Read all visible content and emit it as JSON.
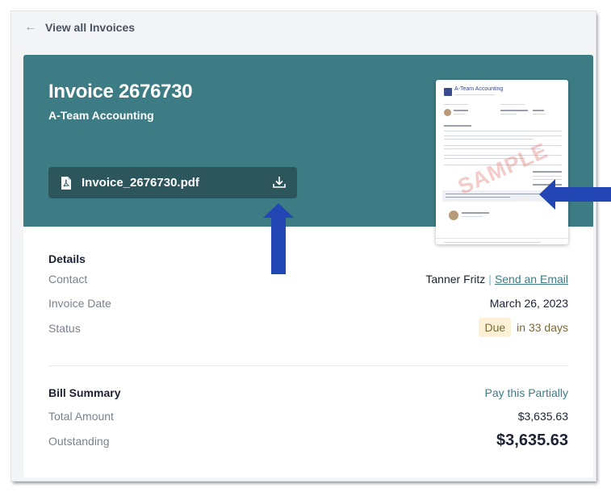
{
  "nav": {
    "back_label": "View all Invoices",
    "back_icon": "arrow-left-icon"
  },
  "invoice": {
    "title": "Invoice 2676730",
    "company": "A-Team Accounting",
    "file_name": "Invoice_2676730.pdf",
    "file_icon": "pdf-file-icon",
    "download_icon": "download-icon"
  },
  "preview": {
    "company_name": "A-Team Accounting",
    "watermark": "SAMPLE"
  },
  "details": {
    "heading": "Details",
    "contact_label": "Contact",
    "contact_name": "Tanner Fritz",
    "separator": "|",
    "contact_link": "Send an Email",
    "date_label": "Invoice Date",
    "date_value": "March 26, 2023",
    "status_label": "Status",
    "status_badge": "Due",
    "status_rest": "in 33 days"
  },
  "bill": {
    "heading": "Bill Summary",
    "pay_link": "Pay this Partially",
    "total_label": "Total Amount",
    "total_value": "$3,635.63",
    "outstanding_label": "Outstanding",
    "outstanding_value": "$3,635.63"
  },
  "colors": {
    "hero": "#3d7c85",
    "file_button": "#2c555c",
    "annotation_arrow": "#2346b5",
    "badge_bg": "#fcf1d6"
  }
}
